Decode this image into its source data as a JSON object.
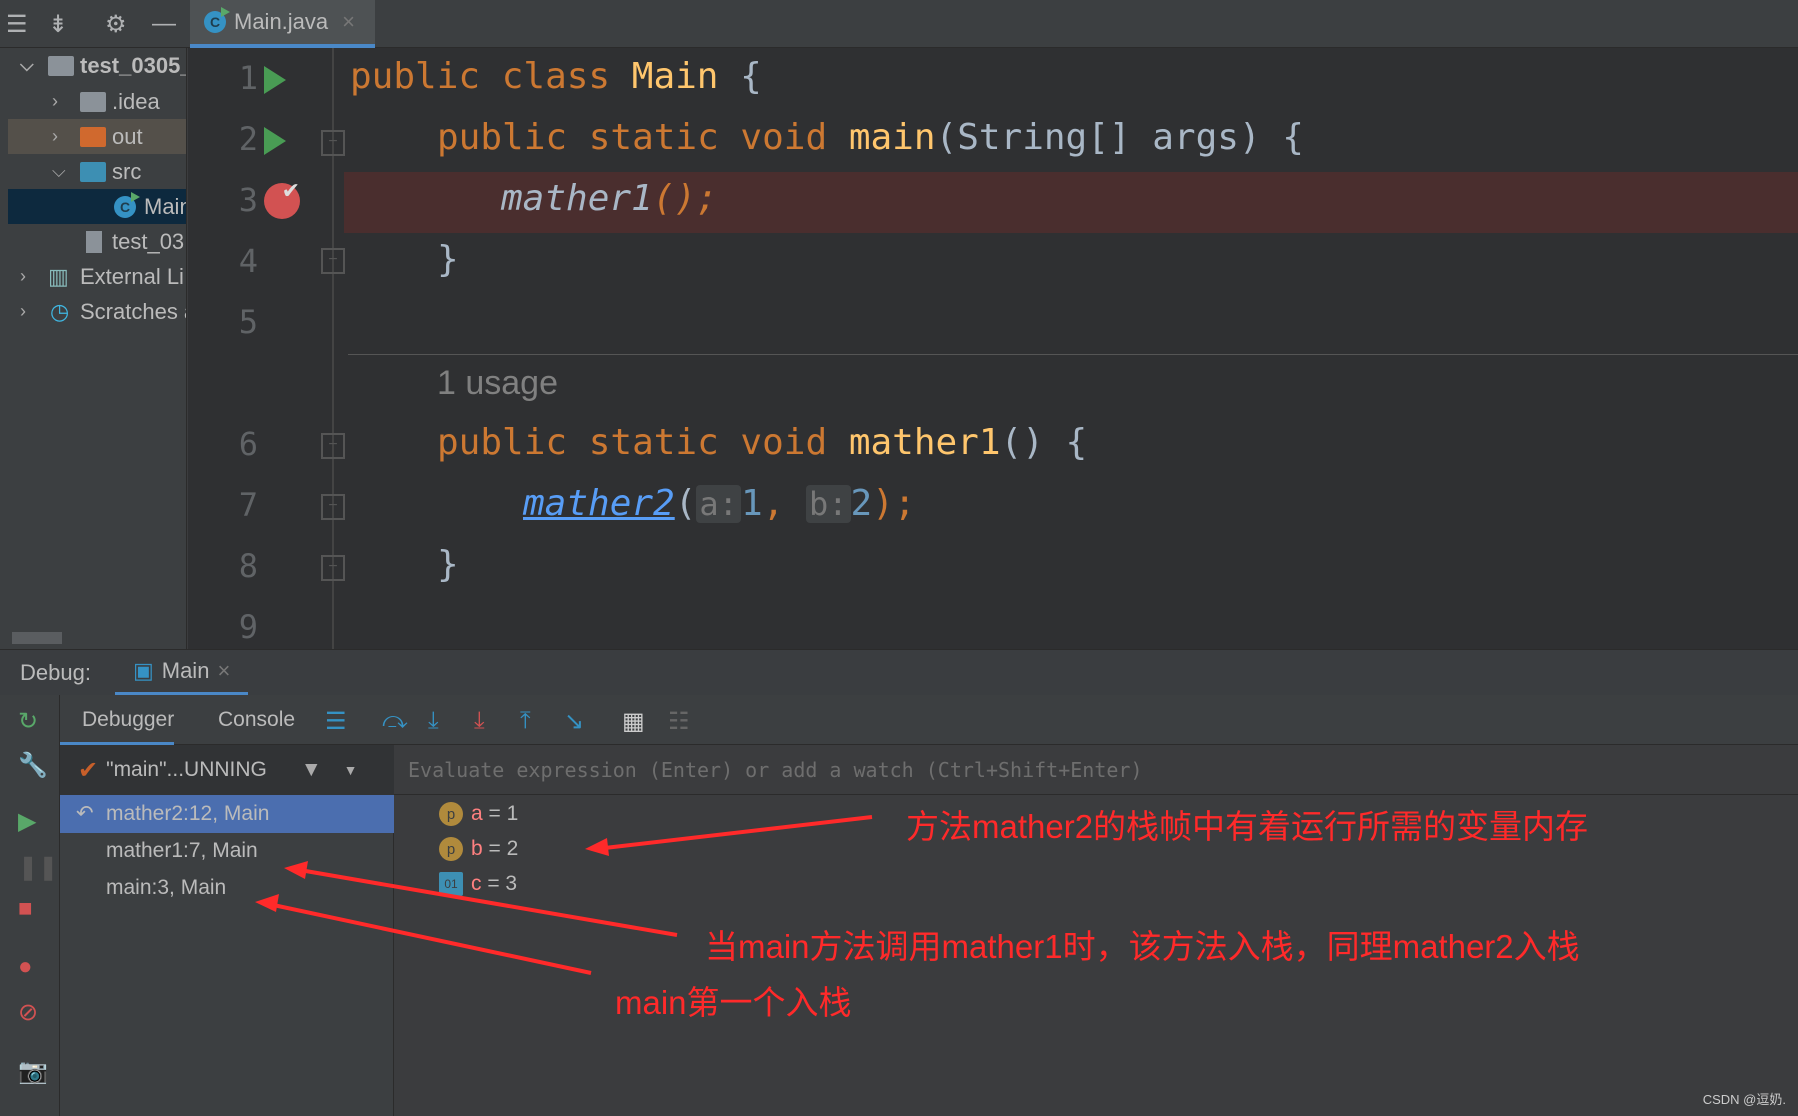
{
  "editor_tab": {
    "label": "Main.java",
    "close": "×"
  },
  "project": {
    "root": "test_0305_",
    "items": [
      ".idea",
      "out",
      "src",
      "Main",
      "test_03",
      "External Li",
      "Scratches a"
    ]
  },
  "editor": {
    "line_numbers": [
      "1",
      "2",
      "3",
      "4",
      "5",
      "6",
      "7",
      "8",
      "9"
    ],
    "usage_hint": "1 usage",
    "line1": {
      "kw": "public class ",
      "name": "Main",
      "rest": " {"
    },
    "line2": {
      "kw": "public static void ",
      "fn": "main",
      "rest": "(String[] args) {"
    },
    "line3": {
      "call": "mather1",
      "rest": "();"
    },
    "line4": "}",
    "line6": {
      "kw": "public static void ",
      "fn": "mather1",
      "rest": "() {"
    },
    "line7": {
      "call": "mather2",
      "open": "(",
      "hint_a": "a:",
      "val_a": "1",
      "comma": ", ",
      "hint_b": "b:",
      "val_b": "2",
      "close": ");"
    },
    "line8": "}"
  },
  "debug": {
    "label": "Debug:",
    "session": "Main",
    "close": "×",
    "tabs": [
      "Debugger",
      "Console"
    ],
    "thread": "\"main\"...UNNING",
    "frames": [
      "mather2:12, Main",
      "mather1:7, Main",
      "main:3, Main"
    ],
    "eval_placeholder": "Evaluate expression (Enter) or add a watch (Ctrl+Shift+Enter)",
    "variables": [
      {
        "badge": "p",
        "name": "a",
        "value": " = 1"
      },
      {
        "badge": "p",
        "name": "b",
        "value": " = 2"
      },
      {
        "badge": "01",
        "name": "c",
        "value": " = 3"
      }
    ]
  },
  "annotations": [
    "方法mather2的栈帧中有着运行所需的变量内存",
    "当main方法调用mather1时，该方法入栈，同理mather2入栈",
    "main第一个入栈"
  ],
  "watermark": "CSDN @逗奶.",
  "colors": {
    "annotation": "#ff2a2a",
    "keyword": "#cc7832",
    "function": "#ffc66d",
    "breakpoint_line": "#4a2e2e",
    "selection": "#4b6eaf"
  }
}
